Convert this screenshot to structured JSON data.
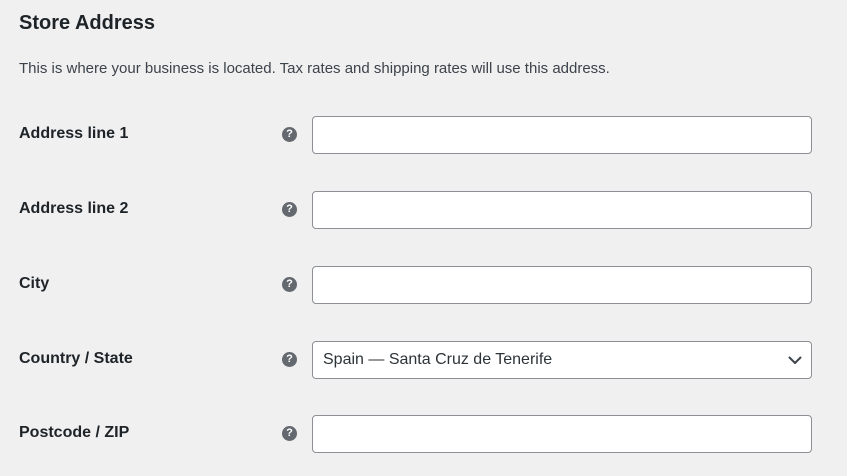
{
  "section": {
    "title": "Store Address",
    "description": "This is where your business is located. Tax rates and shipping rates will use this address."
  },
  "fields": {
    "address1": {
      "label": "Address line 1",
      "value": "",
      "help_icon": "question-circle-icon"
    },
    "address2": {
      "label": "Address line 2",
      "value": "",
      "help_icon": "question-circle-icon"
    },
    "city": {
      "label": "City",
      "value": "",
      "help_icon": "question-circle-icon"
    },
    "country_state": {
      "label": "Country / State",
      "value": "Spain — Santa Cruz de Tenerife",
      "help_icon": "question-circle-icon",
      "dropdown_icon": "chevron-down-icon"
    },
    "postcode": {
      "label": "Postcode / ZIP",
      "value": "",
      "help_icon": "question-circle-icon"
    }
  },
  "icons": {
    "help_glyph": "?"
  },
  "colors": {
    "background": "#f0f0f1",
    "heading": "#1d2327",
    "help_icon": "#646970",
    "field_border": "#8c8f94"
  }
}
